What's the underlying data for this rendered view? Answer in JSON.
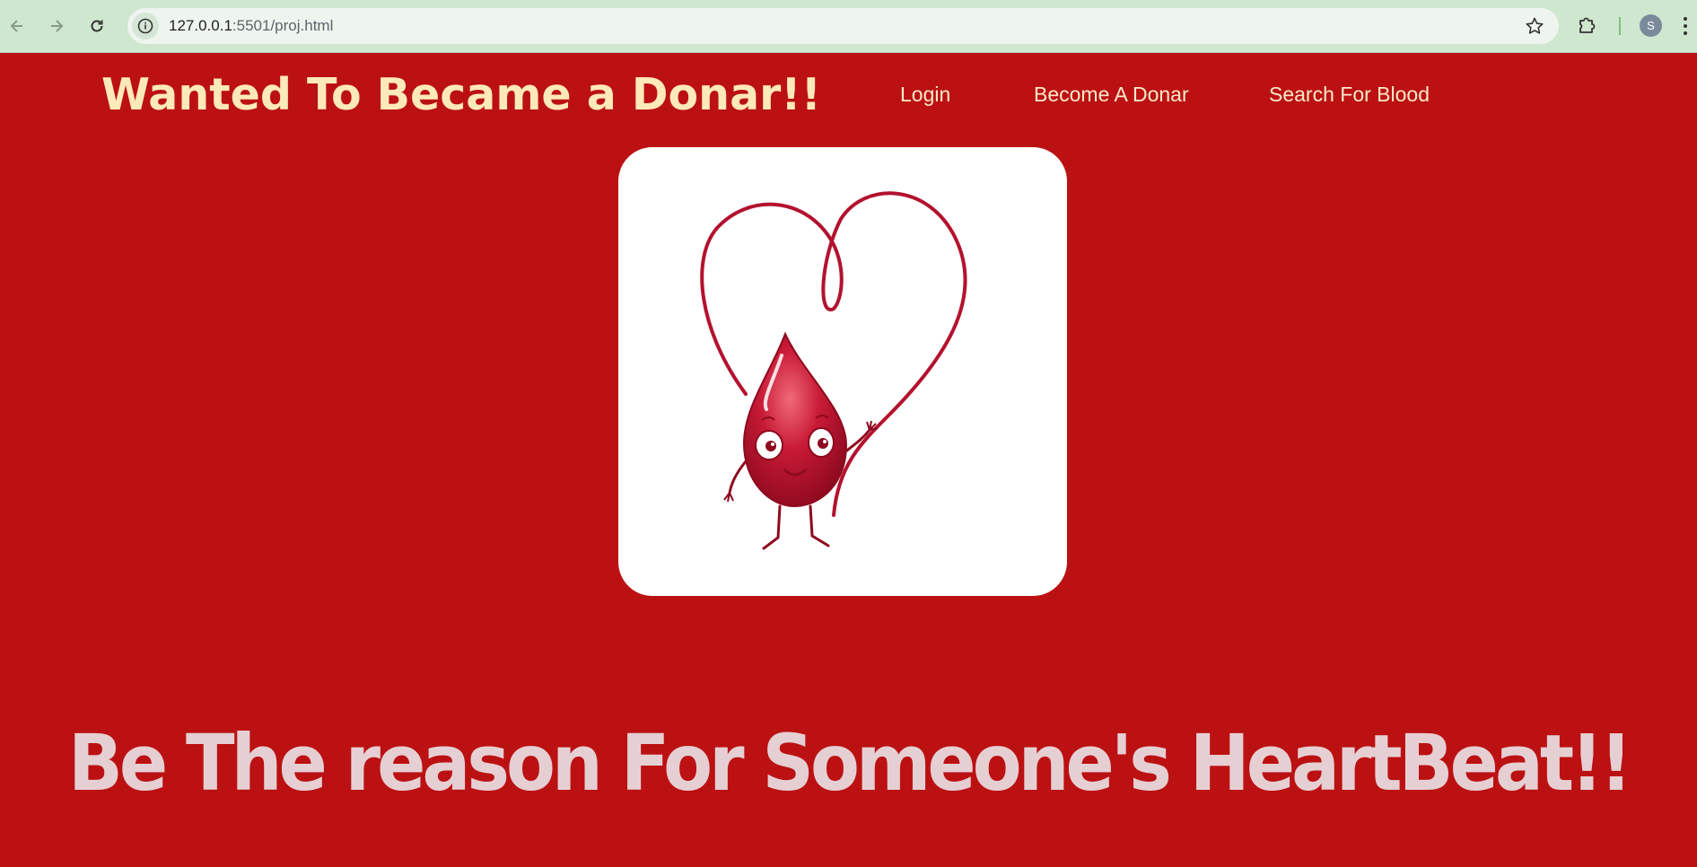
{
  "browser": {
    "url_host": "127.0.0.1",
    "url_path": ":5501/proj.html",
    "profile_initial": "S",
    "icons": {
      "back": "arrow-left-icon",
      "forward": "arrow-right-icon",
      "reload": "reload-icon",
      "site_info": "info-icon",
      "bookmark": "star-icon",
      "extensions": "puzzle-icon",
      "menu": "kebab-icon"
    }
  },
  "header": {
    "title": "Wanted To Became a Donar!!",
    "nav": [
      {
        "label": "Login"
      },
      {
        "label": "Become A Donar"
      },
      {
        "label": "Search For Blood"
      }
    ]
  },
  "hero": {
    "illustration": "blood-drop-heart-illustration",
    "tagline": "Be The reason For Someone's HeartBeat!!"
  },
  "colors": {
    "page_bg": "#bb1112",
    "title": "#fde9b9",
    "nav_text": "#fde9c9",
    "tagline": "#e6cfd3",
    "drop": "#b3122e",
    "chrome_bg": "#cfe6cf"
  }
}
